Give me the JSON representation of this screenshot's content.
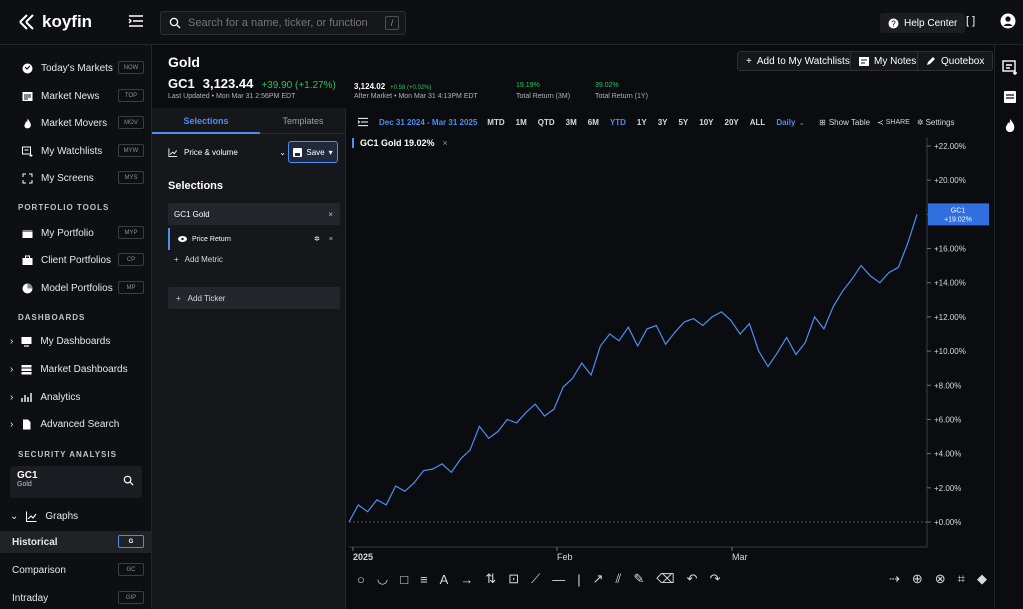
{
  "app": {
    "logo": "koyfin"
  },
  "search": {
    "placeholder": "Search for a name, ticker, or function",
    "shortcut": "/"
  },
  "top": {
    "help": "Help Center",
    "fullscreen": "[ ]"
  },
  "sidebar": {
    "items": [
      {
        "label": "Today's Markets",
        "kbd": "NOW"
      },
      {
        "label": "Market News",
        "kbd": "TOP"
      },
      {
        "label": "Market Movers",
        "kbd": "MOV"
      },
      {
        "label": "My Watchlists",
        "kbd": "MYW"
      },
      {
        "label": "My Screens",
        "kbd": "MYS"
      }
    ],
    "portfolio_label": "PORTFOLIO TOOLS",
    "portfolio_items": [
      {
        "label": "My Portfolio",
        "kbd": "MYP"
      },
      {
        "label": "Client Portfolios",
        "kbd": "CP"
      },
      {
        "label": "Model Portfolios",
        "kbd": "MP"
      }
    ],
    "dashboards_label": "DASHBOARDS",
    "dash_items": [
      "My Dashboards",
      "Market Dashboards",
      "Analytics",
      "Advanced Search"
    ],
    "security_label": "SECURITY ANALYSIS",
    "ticker": "GC1",
    "ticker_name": "Gold",
    "graphs_label": "Graphs",
    "graph_items": [
      {
        "label": "Historical",
        "kbd": "G"
      },
      {
        "label": "Comparison",
        "kbd": "GC"
      },
      {
        "label": "Intraday",
        "kbd": "GIP"
      }
    ]
  },
  "header": {
    "title": "Gold",
    "symbol": "GC1",
    "price": "3,123.44",
    "change": "+39.90 (+1.27%)",
    "last_updated": "Last Updated • Mon Mar 31 2:56PM EDT",
    "after_price": "3,124.02",
    "after_change": "+0.58 (+0.02%)",
    "after_label": "After Market • Mon Mar 31 4:13PM EDT",
    "ret3m_value": "19.19%",
    "ret3m_label": "Total Return (3M)",
    "ret1y_value": "39.02%",
    "ret1y_label": "Total Return (1Y)",
    "add_watchlist": "Add to My Watchlists",
    "notes": "My Notes",
    "quotebox": "Quotebox"
  },
  "leftpanel": {
    "tab_selections": "Selections",
    "tab_templates": "Templates",
    "chart_type": "Price & volume",
    "save": "Save",
    "selections_title": "Selections",
    "ticker_row": "GC1 Gold",
    "metric": "Price Return",
    "add_metric": "Add Metric",
    "add_ticker": "Add Ticker"
  },
  "toolbar": {
    "date_range": "Dec 31 2024 - Mar 31 2025",
    "ranges": [
      "MTD",
      "1M",
      "QTD",
      "3M",
      "6M",
      "YTD",
      "1Y",
      "3Y",
      "5Y",
      "10Y",
      "20Y",
      "ALL"
    ],
    "active_range": "YTD",
    "interval": "Daily",
    "show_table": "Show Table",
    "share": "SHARE",
    "settings": "Settings"
  },
  "chart_data": {
    "type": "line",
    "legend": "GC1  Gold  19.02%",
    "series": [
      {
        "name": "GC1 Gold",
        "color": "#4d8ef0",
        "x": [
          0,
          1,
          2,
          3,
          4,
          5,
          6,
          7,
          8,
          9,
          10,
          11,
          12,
          13,
          14,
          15,
          16,
          17,
          18,
          19,
          20,
          21,
          22,
          23,
          24,
          25,
          26,
          27,
          28,
          29,
          30,
          31,
          32,
          33,
          34,
          35,
          36,
          37,
          38,
          39,
          40,
          41,
          42,
          43,
          44,
          45,
          46,
          47,
          48,
          49,
          50,
          51,
          52,
          53,
          54,
          55,
          56,
          57,
          58,
          59,
          60,
          61
        ],
        "values": [
          0.0,
          1.0,
          0.6,
          1.3,
          1.0,
          2.1,
          1.8,
          2.3,
          3.0,
          3.1,
          3.4,
          2.9,
          3.7,
          4.2,
          5.6,
          4.9,
          5.3,
          6.0,
          5.8,
          6.4,
          6.9,
          6.2,
          6.6,
          7.9,
          8.4,
          9.3,
          8.6,
          10.3,
          11.0,
          10.6,
          11.4,
          10.3,
          11.3,
          11.5,
          10.4,
          11.1,
          11.7,
          11.9,
          11.5,
          12.0,
          12.3,
          11.8,
          11.0,
          11.6,
          10.0,
          9.1,
          9.9,
          10.8,
          9.8,
          10.5,
          12.0,
          11.3,
          12.6,
          13.5,
          14.2,
          15.0,
          14.4,
          14.0,
          14.6,
          14.9,
          16.3,
          18.0
        ]
      }
    ],
    "y_ticks": [
      "+22.00%",
      "+20.00%",
      "+18.00%",
      "+16.00%",
      "+14.00%",
      "+12.00%",
      "+10.00%",
      "+8.00%",
      "+6.00%",
      "+4.00%",
      "+2.00%",
      "+0.00%"
    ],
    "x_ticks": [
      "2025",
      "Feb",
      "Mar"
    ],
    "last_label_symbol": "GC1",
    "last_label_value": "+19.02%",
    "ylim": [
      0,
      22
    ]
  }
}
